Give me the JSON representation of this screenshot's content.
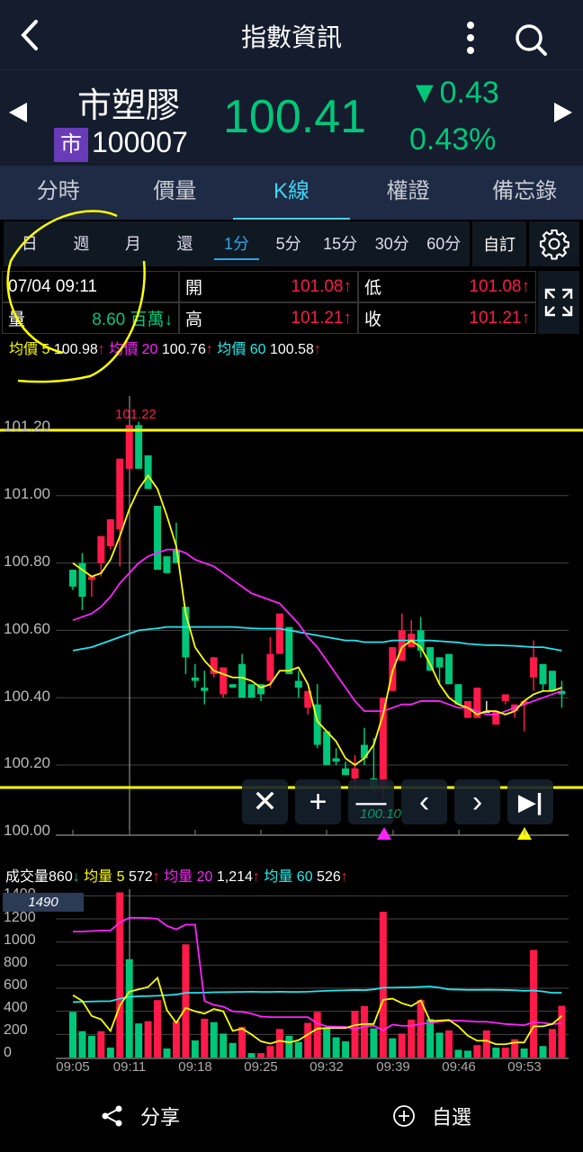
{
  "header": {
    "title": "指數資訊",
    "back": "back-icon",
    "more": "more-icon",
    "search": "search-icon"
  },
  "quote": {
    "name": "市塑膠",
    "badge": "市",
    "code": "100007",
    "price": "100.41",
    "change": "▼0.43",
    "change_pct": "0.43%"
  },
  "tabs": [
    "分時",
    "價量",
    "K線",
    "權證",
    "備忘錄"
  ],
  "periods": [
    "日",
    "週",
    "月",
    "還",
    "1分",
    "5分",
    "15分",
    "30分",
    "60分"
  ],
  "custom": "自訂",
  "info": {
    "datetime": "07/04 09:11",
    "vol_label": "量",
    "vol": "8.60 百萬↓",
    "open_label": "開",
    "open": "101.08↑",
    "high_label": "高",
    "high": "101.21↑",
    "low_label": "低",
    "low": "101.08↑",
    "close_label": "收",
    "close": "101.21↑"
  },
  "ma": {
    "l5": "均價 5",
    "v5": "100.98",
    "l20": "均價 20",
    "v20": "100.76",
    "l60": "均價 60",
    "v60": "100.58",
    "arrow": "↑"
  },
  "vol_ma": {
    "l0": "成交量",
    "v0": "860",
    "a0": "↓",
    "l5": "均量 5",
    "v5": "572",
    "l20": "均量 20",
    "v20": "1,214",
    "l60": "均量 60",
    "v60": "526",
    "arrow": "↑"
  },
  "controls": [
    "✕",
    "+",
    "—",
    "‹",
    "›",
    "▶|"
  ],
  "bottom": {
    "share": "分享",
    "watch": "自選"
  },
  "colors": {
    "up": "#ff1a4a",
    "down": "#00c77a",
    "ma5": "#ffff00",
    "ma20": "#ff22ff",
    "ma60": "#22e5f0"
  },
  "chart_data": [
    {
      "type": "candlestick",
      "title": "K線 1分",
      "ylim": [
        100.0,
        101.25
      ],
      "yticks": [
        "101.20",
        "101.00",
        "100.80",
        "100.60",
        "100.40",
        "100.20",
        "100.00"
      ],
      "high_label": "101.22",
      "low_label": "100.10",
      "ohlc": [
        [
          100.78,
          100.78,
          100.72,
          100.73
        ],
        [
          100.8,
          100.83,
          100.66,
          100.7
        ],
        [
          100.75,
          100.76,
          100.7,
          100.76
        ],
        [
          100.8,
          100.88,
          100.76,
          100.88
        ],
        [
          100.85,
          100.93,
          100.84,
          100.93
        ],
        [
          100.9,
          101.11,
          100.79,
          101.11
        ],
        [
          101.08,
          101.21,
          101.08,
          101.21
        ],
        [
          101.21,
          101.22,
          101.08,
          101.08
        ],
        [
          101.12,
          101.12,
          101.02,
          101.02
        ],
        [
          100.97,
          100.97,
          100.78,
          100.78
        ],
        [
          100.82,
          100.82,
          100.77,
          100.77
        ],
        [
          100.84,
          100.92,
          100.8,
          100.8
        ],
        [
          100.67,
          100.67,
          100.47,
          100.52
        ],
        [
          100.46,
          100.5,
          100.43,
          100.45
        ],
        [
          100.43,
          100.48,
          100.38,
          100.42
        ],
        [
          100.47,
          100.52,
          100.46,
          100.52
        ],
        [
          100.41,
          100.49,
          100.4,
          100.49
        ],
        [
          100.44,
          100.44,
          100.43,
          100.43
        ],
        [
          100.5,
          100.53,
          100.4,
          100.4
        ],
        [
          100.44,
          100.44,
          100.4,
          100.4
        ],
        [
          100.44,
          100.44,
          100.39,
          100.41
        ],
        [
          100.45,
          100.58,
          100.43,
          100.53
        ],
        [
          100.53,
          100.65,
          100.53,
          100.65
        ],
        [
          100.61,
          100.61,
          100.47,
          100.47
        ],
        [
          100.45,
          100.48,
          100.4,
          100.43
        ],
        [
          100.37,
          100.42,
          100.35,
          100.42
        ],
        [
          100.38,
          100.44,
          100.25,
          100.26
        ],
        [
          100.3,
          100.3,
          100.2,
          100.2
        ],
        [
          100.22,
          100.25,
          100.2,
          100.21
        ],
        [
          100.19,
          100.21,
          100.17,
          100.17
        ],
        [
          100.16,
          100.23,
          100.12,
          100.19
        ],
        [
          100.26,
          100.31,
          100.2,
          100.22
        ],
        [
          100.16,
          100.28,
          100.12,
          100.13
        ],
        [
          100.13,
          100.4,
          100.1,
          100.4
        ],
        [
          100.42,
          100.55,
          100.42,
          100.55
        ],
        [
          100.51,
          100.65,
          100.51,
          100.6
        ],
        [
          100.55,
          100.63,
          100.55,
          100.59
        ],
        [
          100.6,
          100.64,
          100.52,
          100.54
        ],
        [
          100.55,
          100.55,
          100.48,
          100.48
        ],
        [
          100.52,
          100.52,
          100.44,
          100.49
        ],
        [
          100.53,
          100.53,
          100.44,
          100.44
        ],
        [
          100.44,
          100.44,
          100.38,
          100.38
        ],
        [
          100.34,
          100.39,
          100.34,
          100.39
        ],
        [
          100.34,
          100.43,
          100.34,
          100.43
        ],
        [
          100.36,
          100.39,
          100.36,
          100.36
        ],
        [
          100.32,
          100.36,
          100.32,
          100.36
        ],
        [
          100.39,
          100.41,
          100.38,
          100.41
        ],
        [
          100.36,
          100.38,
          100.34,
          100.38
        ],
        [
          100.38,
          100.39,
          100.3,
          100.39
        ],
        [
          100.46,
          100.57,
          100.42,
          100.52
        ],
        [
          100.5,
          100.5,
          100.42,
          100.44
        ],
        [
          100.48,
          100.48,
          100.42,
          100.42
        ],
        [
          100.42,
          100.45,
          100.37,
          100.41
        ]
      ],
      "ma5": [
        100.8,
        100.78,
        100.76,
        100.77,
        100.81,
        100.88,
        100.96,
        101.02,
        101.06,
        101.02,
        100.94,
        100.85,
        100.65,
        100.55,
        100.51,
        100.48,
        100.47,
        100.46,
        100.46,
        100.45,
        100.43,
        100.44,
        100.48,
        100.48,
        100.49,
        100.44,
        100.33,
        100.3,
        100.27,
        100.22,
        100.2,
        100.22,
        100.26,
        100.35,
        100.48,
        100.55,
        100.57,
        100.55,
        100.5,
        100.44,
        100.4,
        100.38,
        100.37,
        100.35,
        100.36,
        100.36,
        100.35,
        100.36,
        100.39,
        100.41,
        100.42,
        100.42,
        100.43
      ],
      "ma20": [
        100.63,
        100.64,
        100.65,
        100.67,
        100.7,
        100.74,
        100.77,
        100.8,
        100.82,
        100.83,
        100.84,
        100.84,
        100.83,
        100.81,
        100.8,
        100.79,
        100.77,
        100.75,
        100.73,
        100.71,
        100.7,
        100.69,
        100.68,
        100.65,
        100.62,
        100.58,
        100.55,
        100.51,
        100.47,
        100.43,
        100.39,
        100.36,
        100.36,
        100.36,
        100.37,
        100.38,
        100.38,
        100.39,
        100.39,
        100.39,
        100.38,
        100.37,
        100.37,
        100.36,
        100.35,
        100.35,
        100.36,
        100.37,
        100.38,
        100.39,
        100.4,
        100.41,
        100.42
      ],
      "ma60": [
        100.54,
        100.545,
        100.55,
        100.56,
        100.57,
        100.58,
        100.59,
        100.6,
        100.603,
        100.606,
        100.61,
        100.61,
        100.61,
        100.61,
        100.61,
        100.61,
        100.61,
        100.61,
        100.608,
        100.606,
        100.605,
        100.605,
        100.605,
        100.6,
        100.595,
        100.59,
        100.585,
        100.58,
        100.575,
        100.57,
        100.57,
        100.565,
        100.565,
        100.565,
        100.57,
        100.57,
        100.57,
        100.57,
        100.57,
        100.568,
        100.566,
        100.564,
        100.56,
        100.558,
        100.556,
        100.556,
        100.555,
        100.554,
        100.552,
        100.55,
        100.55,
        100.545,
        100.54
      ]
    },
    {
      "type": "bar",
      "title": "成交量",
      "ylim": [
        0,
        1400
      ],
      "yticks": [
        "1400",
        "1200",
        "1000",
        "800",
        "600",
        "400",
        "200",
        "0"
      ],
      "max_label": "1490",
      "x": [
        "09:05",
        "09:11",
        "09:18",
        "09:25",
        "09:32",
        "09:39",
        "09:46",
        "09:53"
      ],
      "values": [
        395,
        228,
        188,
        228,
        86,
        1490,
        851,
        295,
        314,
        497,
        78,
        314,
        980,
        148,
        336,
        306,
        207,
        126,
        266,
        38,
        38,
        100,
        247,
        188,
        134,
        300,
        395,
        260,
        175,
        140,
        405,
        446,
        252,
        1262,
        166,
        207,
        328,
        497,
        333,
        215,
        234,
        67,
        59,
        107,
        234,
        86,
        86,
        158,
        78,
        932,
        99,
        247,
        448
      ],
      "up": [
        0,
        0,
        0,
        1,
        0,
        1,
        0,
        0,
        1,
        1,
        0,
        1,
        1,
        0,
        1,
        0,
        0,
        0,
        1,
        0,
        1,
        1,
        1,
        0,
        0,
        1,
        1,
        0,
        0,
        0,
        1,
        1,
        0,
        1,
        0,
        1,
        1,
        1,
        0,
        0,
        1,
        0,
        0,
        1,
        1,
        0,
        1,
        1,
        0,
        1,
        0,
        1,
        1
      ],
      "ma5": [
        540,
        490,
        360,
        330,
        230,
        450,
        570,
        590,
        610,
        690,
        410,
        300,
        430,
        400,
        380,
        420,
        400,
        230,
        250,
        200,
        140,
        120,
        145,
        130,
        150,
        200,
        250,
        255,
        255,
        255,
        280,
        290,
        290,
        500,
        510,
        470,
        445,
        495,
        315,
        320,
        325,
        270,
        190,
        145,
        145,
        115,
        115,
        130,
        130,
        270,
        270,
        290,
        360
      ],
      "ma20": [
        1090,
        1090,
        1095,
        1100,
        1100,
        1170,
        1210,
        1210,
        1208,
        1200,
        1140,
        1110,
        1150,
        1150,
        490,
        455,
        440,
        400,
        395,
        380,
        355,
        350,
        350,
        350,
        350,
        350,
        295,
        270,
        268,
        265,
        245,
        270,
        275,
        235,
        285,
        275,
        275,
        290,
        300,
        310,
        320,
        320,
        315,
        310,
        310,
        300,
        290,
        285,
        280,
        305,
        300,
        290,
        295
      ],
      "ma60": [
        480,
        482,
        485,
        487,
        488,
        510,
        525,
        530,
        532,
        535,
        540,
        545,
        560,
        560,
        562,
        565,
        566,
        567,
        568,
        570,
        568,
        568,
        570,
        568,
        568,
        570,
        574,
        578,
        580,
        582,
        585,
        583,
        590,
        605,
        605,
        607,
        608,
        612,
        615,
        605,
        590,
        588,
        586,
        586,
        587,
        586,
        585,
        582,
        578,
        580,
        572,
        560,
        560
      ]
    }
  ]
}
